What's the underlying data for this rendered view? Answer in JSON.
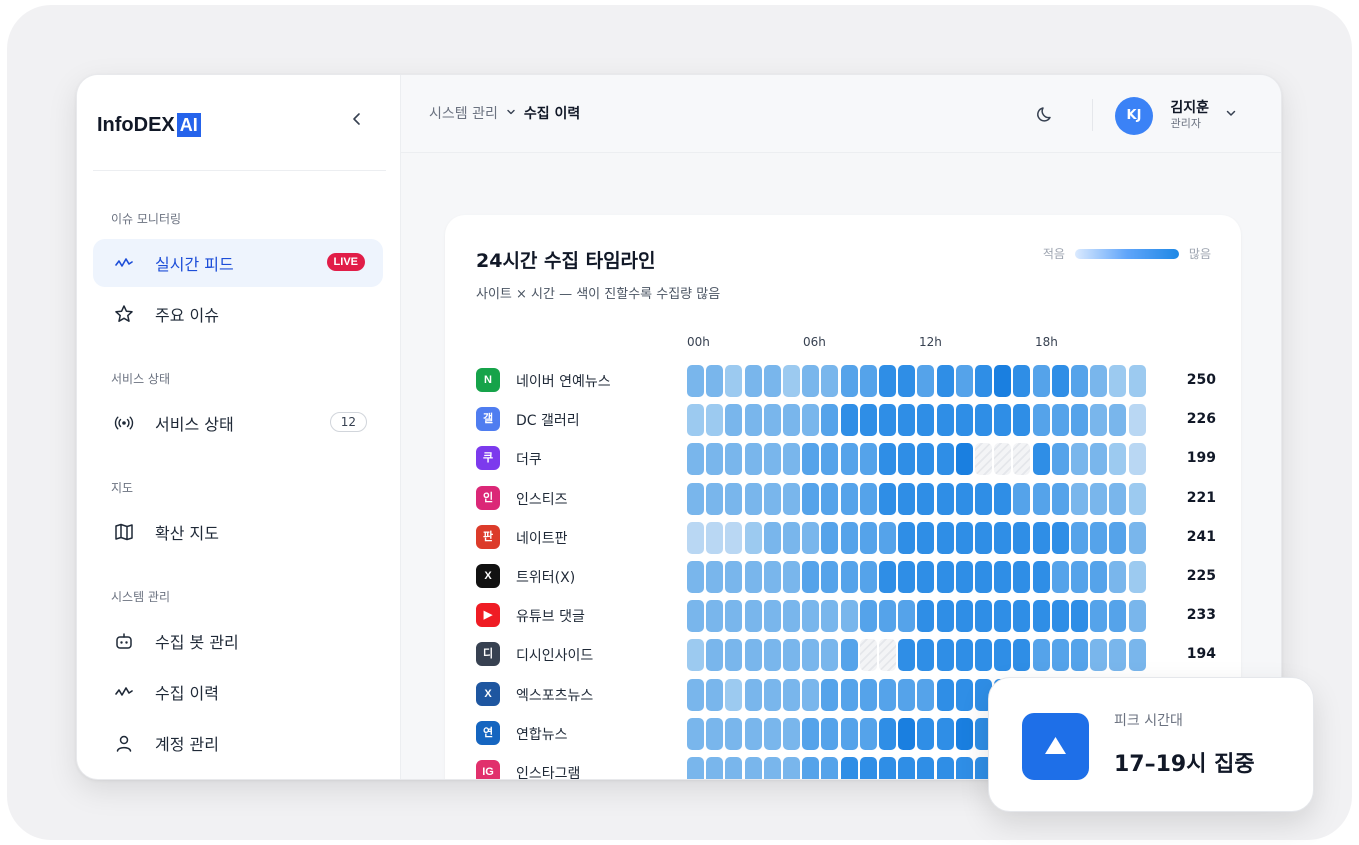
{
  "app": {
    "logo_text": "InfoDEX",
    "logo_badge": "AI",
    "collapse_icon": "chevron-left-icon"
  },
  "sidebar": {
    "sections": [
      {
        "label": "이슈 모니터링"
      },
      {
        "label": "서비스 상태"
      },
      {
        "label": "지도"
      },
      {
        "label": "시스템 관리"
      }
    ],
    "items": [
      {
        "label": "실시간 피드",
        "icon": "activity-icon",
        "badge": "LIVE",
        "active": true
      },
      {
        "label": "주요 이슈",
        "icon": "star-icon"
      },
      {
        "label": "서비스 상태",
        "icon": "broadcast-icon",
        "count": "12"
      },
      {
        "label": "확산 지도",
        "icon": "map-icon"
      },
      {
        "label": "수집 봇 관리",
        "icon": "bot-icon"
      },
      {
        "label": "수집 이력",
        "icon": "activity-icon"
      },
      {
        "label": "계정 관리",
        "icon": "user-icon"
      }
    ]
  },
  "header": {
    "breadcrumb_parent": "시스템 관리",
    "breadcrumb_current": "수집 이력",
    "theme_icon": "moon-icon",
    "user": {
      "initials": "KJ",
      "name": "김지훈",
      "role": "관리자"
    }
  },
  "card": {
    "title": "24시간 수집 타임라인",
    "subtitle": "사이트 × 시간 — 색이 진할수록 수집량 많음",
    "legend_low": "적음",
    "legend_high": "많음",
    "hour_labels": [
      "00h",
      "06h",
      "12h",
      "18h"
    ]
  },
  "colors": {
    "accent": "#2563eb",
    "live": "#e11d48",
    "heat": [
      "#d6e7f8",
      "#b9d7f3",
      "#9ccaf0",
      "#79b6ec",
      "#55a3ea",
      "#2f8ee6",
      "#1a7fe0"
    ]
  },
  "chart_data": {
    "type": "heatmap",
    "x": [
      "0",
      "1",
      "2",
      "3",
      "4",
      "5",
      "6",
      "7",
      "8",
      "9",
      "10",
      "11",
      "12",
      "13",
      "14",
      "15",
      "16",
      "17",
      "18",
      "19",
      "20",
      "21",
      "22",
      "23"
    ],
    "rows": [
      {
        "name": "네이버 연예뉴스",
        "icon_text": "N",
        "icon_color": "#16a34a",
        "total": "250",
        "levels": [
          3,
          3,
          2,
          3,
          3,
          2,
          3,
          3,
          4,
          4,
          5,
          5,
          4,
          5,
          4,
          5,
          6,
          5,
          4,
          5,
          4,
          3,
          2,
          2
        ]
      },
      {
        "name": "DC 갤러리",
        "icon_text": "갤",
        "icon_color": "#4f7df0",
        "total": "226",
        "levels": [
          2,
          2,
          3,
          3,
          3,
          3,
          3,
          4,
          5,
          5,
          5,
          5,
          5,
          5,
          5,
          5,
          5,
          5,
          4,
          4,
          4,
          3,
          3,
          1
        ]
      },
      {
        "name": "더쿠",
        "icon_text": "쿠",
        "icon_color": "#7c3aed",
        "total": "199",
        "levels": [
          3,
          3,
          3,
          3,
          3,
          3,
          4,
          4,
          4,
          4,
          5,
          5,
          5,
          5,
          6,
          -1,
          -1,
          -1,
          5,
          4,
          3,
          3,
          2,
          1
        ]
      },
      {
        "name": "인스티즈",
        "icon_text": "인",
        "icon_color": "#db2777",
        "total": "221",
        "levels": [
          3,
          3,
          3,
          3,
          3,
          3,
          4,
          4,
          4,
          4,
          5,
          5,
          5,
          5,
          5,
          5,
          5,
          4,
          4,
          4,
          3,
          3,
          3,
          2
        ]
      },
      {
        "name": "네이트판",
        "icon_text": "판",
        "icon_color": "#dc3b2a",
        "total": "241",
        "levels": [
          1,
          1,
          1,
          2,
          3,
          3,
          3,
          4,
          4,
          4,
          4,
          5,
          5,
          5,
          5,
          5,
          5,
          5,
          5,
          5,
          4,
          4,
          4,
          3
        ]
      },
      {
        "name": "트위터(X)",
        "icon_text": "X",
        "icon_color": "#111111",
        "total": "225",
        "levels": [
          3,
          3,
          3,
          3,
          3,
          3,
          4,
          4,
          4,
          4,
          5,
          5,
          5,
          5,
          5,
          5,
          5,
          5,
          5,
          4,
          4,
          4,
          3,
          2
        ]
      },
      {
        "name": "유튜브 댓글",
        "icon_text": "▶",
        "icon_color": "#ef1c24",
        "total": "233",
        "levels": [
          3,
          3,
          3,
          3,
          3,
          3,
          3,
          3,
          3,
          4,
          4,
          4,
          5,
          5,
          5,
          5,
          5,
          5,
          5,
          5,
          5,
          4,
          4,
          3
        ]
      },
      {
        "name": "디시인사이드",
        "icon_text": "디",
        "icon_color": "#374151",
        "total": "194",
        "levels": [
          2,
          3,
          3,
          3,
          3,
          3,
          3,
          3,
          4,
          -1,
          -1,
          5,
          5,
          5,
          5,
          5,
          5,
          5,
          4,
          4,
          4,
          3,
          3,
          3
        ]
      },
      {
        "name": "엑스포츠뉴스",
        "icon_text": "X",
        "icon_color": "#1e56a0",
        "total": "",
        "levels": [
          3,
          3,
          2,
          3,
          3,
          3,
          3,
          4,
          4,
          4,
          4,
          4,
          4,
          5,
          5,
          5,
          5,
          5,
          5,
          4,
          4,
          3,
          3,
          2
        ]
      },
      {
        "name": "연합뉴스",
        "icon_text": "연",
        "icon_color": "#1565c0",
        "total": "",
        "levels": [
          3,
          3,
          3,
          3,
          3,
          3,
          4,
          4,
          4,
          4,
          5,
          6,
          5,
          5,
          6,
          5,
          5,
          5,
          4,
          4,
          3,
          3,
          3,
          2
        ]
      },
      {
        "name": "인스타그램",
        "icon_text": "IG",
        "icon_color": "#e1306c",
        "total": "",
        "levels": [
          3,
          3,
          3,
          3,
          3,
          3,
          4,
          4,
          5,
          5,
          5,
          5,
          5,
          5,
          5,
          5,
          5,
          5,
          4,
          4,
          3,
          3,
          3,
          2
        ]
      }
    ]
  },
  "peak": {
    "label": "피크 시간대",
    "value": "17–19시 집중",
    "icon": "arrow-up-icon"
  }
}
